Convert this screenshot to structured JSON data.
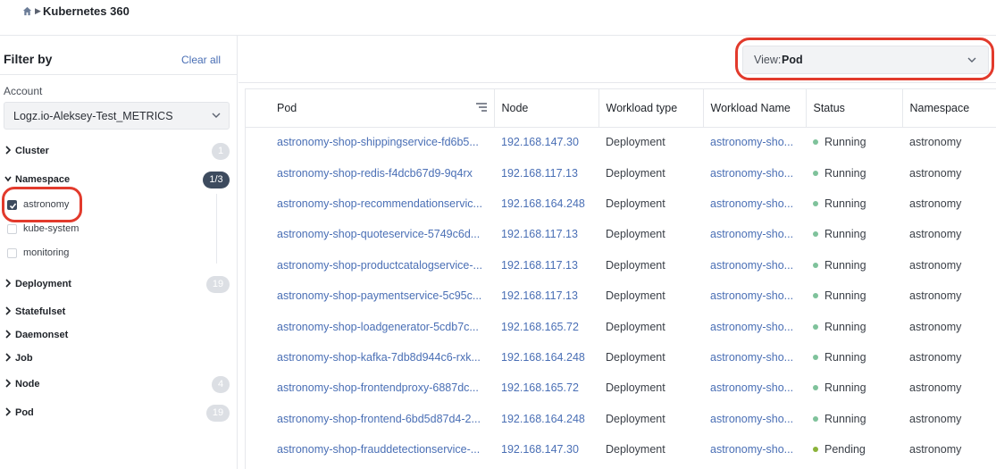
{
  "header": {
    "title": "Kubernetes 360"
  },
  "sidebar": {
    "title": "Filter by",
    "clear_all": "Clear all",
    "account_label": "Account",
    "account_value": "Logz.io-Aleksey-Test_METRICS",
    "facets": {
      "cluster": {
        "label": "Cluster",
        "count": "1"
      },
      "namespace": {
        "label": "Namespace",
        "count": "1/3"
      },
      "deployment": {
        "label": "Deployment",
        "count": "19"
      },
      "statefulset": {
        "label": "Statefulset"
      },
      "daemonset": {
        "label": "Daemonset"
      },
      "job": {
        "label": "Job"
      },
      "node": {
        "label": "Node",
        "count": "4"
      },
      "pod": {
        "label": "Pod",
        "count": "19"
      }
    },
    "namespace_options": [
      {
        "label": "astronomy",
        "checked": true
      },
      {
        "label": "kube-system",
        "checked": false
      },
      {
        "label": "monitoring",
        "checked": false
      }
    ]
  },
  "view": {
    "prefix": "View:",
    "value": "Pod"
  },
  "table": {
    "columns": [
      "Pod",
      "Node",
      "Workload type",
      "Workload Name",
      "Status",
      "Namespace"
    ],
    "rows": [
      {
        "pod": "astronomy-shop-shippingservice-fd6b5...",
        "node": "192.168.147.30",
        "workload_type": "Deployment",
        "workload_name": "astronomy-sho...",
        "status": "Running",
        "namespace": "astronomy"
      },
      {
        "pod": "astronomy-shop-redis-f4dcb67d9-9q4rx",
        "node": "192.168.117.13",
        "workload_type": "Deployment",
        "workload_name": "astronomy-sho...",
        "status": "Running",
        "namespace": "astronomy"
      },
      {
        "pod": "astronomy-shop-recommendationservic...",
        "node": "192.168.164.248",
        "workload_type": "Deployment",
        "workload_name": "astronomy-sho...",
        "status": "Running",
        "namespace": "astronomy"
      },
      {
        "pod": "astronomy-shop-quoteservice-5749c6d...",
        "node": "192.168.117.13",
        "workload_type": "Deployment",
        "workload_name": "astronomy-sho...",
        "status": "Running",
        "namespace": "astronomy"
      },
      {
        "pod": "astronomy-shop-productcatalogservice-...",
        "node": "192.168.117.13",
        "workload_type": "Deployment",
        "workload_name": "astronomy-sho...",
        "status": "Running",
        "namespace": "astronomy"
      },
      {
        "pod": "astronomy-shop-paymentservice-5c95c...",
        "node": "192.168.117.13",
        "workload_type": "Deployment",
        "workload_name": "astronomy-sho...",
        "status": "Running",
        "namespace": "astronomy"
      },
      {
        "pod": "astronomy-shop-loadgenerator-5cdb7c...",
        "node": "192.168.165.72",
        "workload_type": "Deployment",
        "workload_name": "astronomy-sho...",
        "status": "Running",
        "namespace": "astronomy"
      },
      {
        "pod": "astronomy-shop-kafka-7db8d944c6-rxk...",
        "node": "192.168.164.248",
        "workload_type": "Deployment",
        "workload_name": "astronomy-sho...",
        "status": "Running",
        "namespace": "astronomy"
      },
      {
        "pod": "astronomy-shop-frontendproxy-6887dc...",
        "node": "192.168.165.72",
        "workload_type": "Deployment",
        "workload_name": "astronomy-sho...",
        "status": "Running",
        "namespace": "astronomy"
      },
      {
        "pod": "astronomy-shop-frontend-6bd5d87d4-2...",
        "node": "192.168.164.248",
        "workload_type": "Deployment",
        "workload_name": "astronomy-sho...",
        "status": "Running",
        "namespace": "astronomy"
      },
      {
        "pod": "astronomy-shop-frauddetectionservice-...",
        "node": "192.168.147.30",
        "workload_type": "Deployment",
        "workload_name": "astronomy-sho...",
        "status": "Pending",
        "namespace": "astronomy"
      }
    ]
  },
  "colors": {
    "running": "#7fc29b",
    "pending": "#8bb33a",
    "highlight": "#e23a2c",
    "link": "#4a6fb5"
  }
}
